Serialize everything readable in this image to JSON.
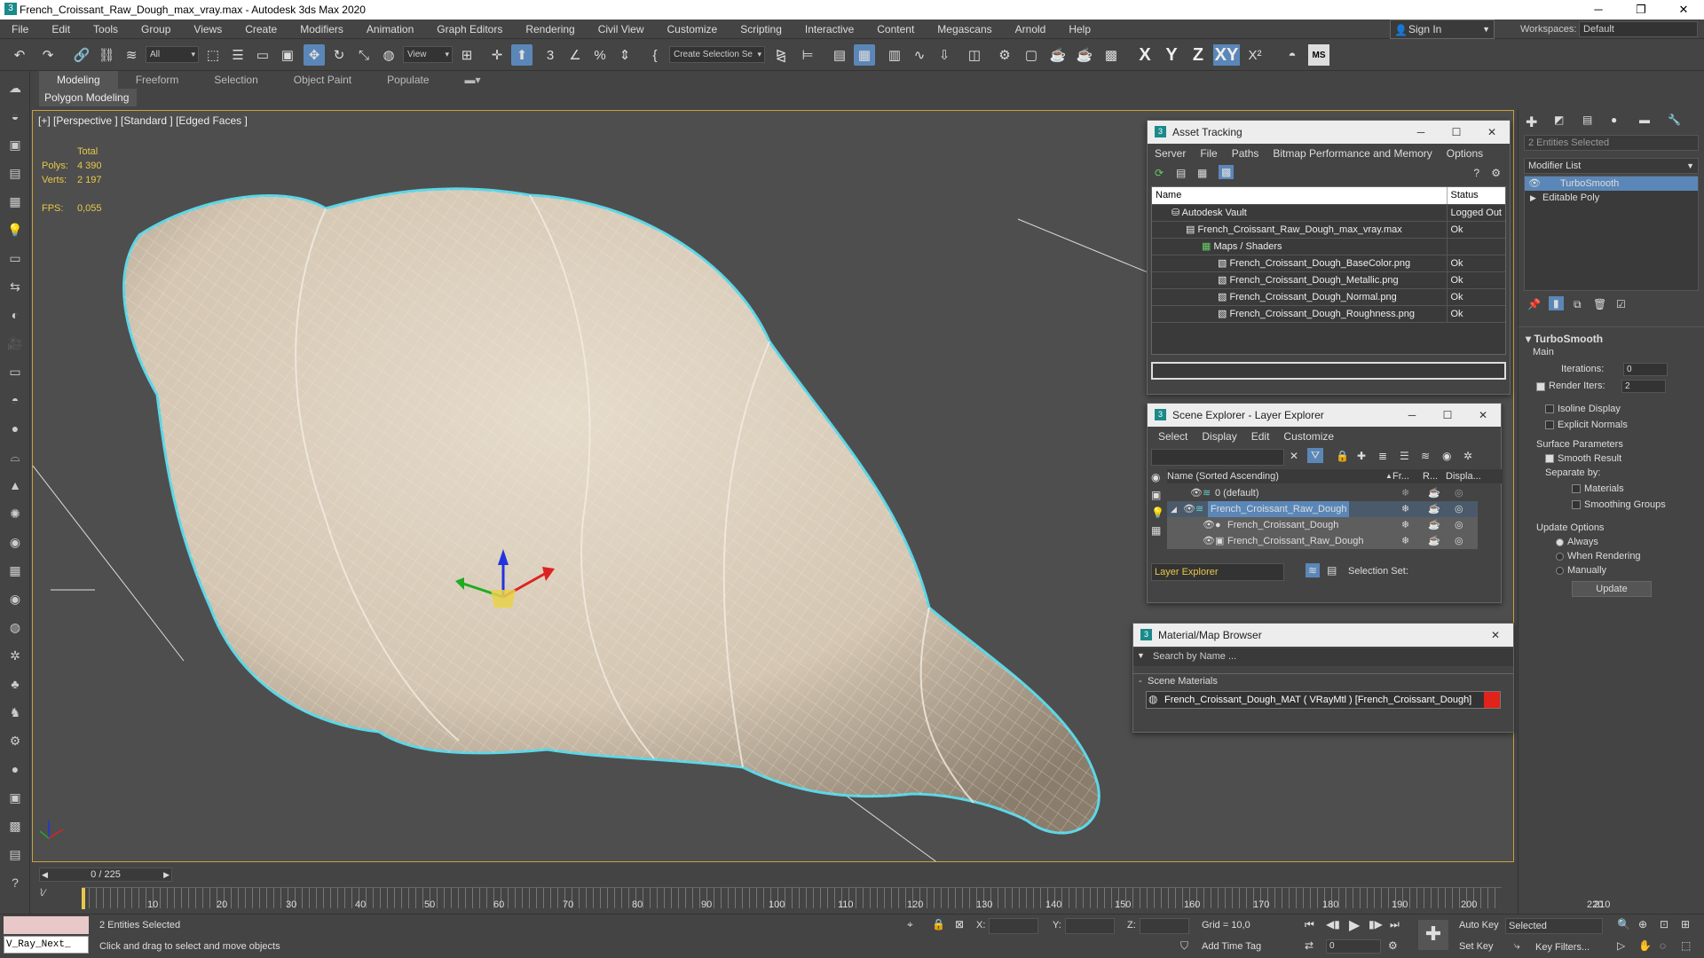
{
  "window": {
    "title": "French_Croissant_Raw_Dough_max_vray.max - Autodesk 3ds Max 2020"
  },
  "menu": [
    "File",
    "Edit",
    "Tools",
    "Group",
    "Views",
    "Create",
    "Modifiers",
    "Animation",
    "Graph Editors",
    "Rendering",
    "Civil View",
    "Customize",
    "Scripting",
    "Interactive",
    "Content",
    "Megascans",
    "Arnold",
    "Help"
  ],
  "signin": "Sign In",
  "workspaces": {
    "label": "Workspaces:",
    "value": "Default"
  },
  "toolbar": {
    "filter": "All",
    "refcoord": "View",
    "selset": "Create Selection Se",
    "axes": [
      "X",
      "Y",
      "Z",
      "XY"
    ]
  },
  "ribbon": {
    "tabs": [
      "Modeling",
      "Freeform",
      "Selection",
      "Object Paint",
      "Populate"
    ],
    "sub": "Polygon Modeling"
  },
  "viewport": {
    "label": "[+] [Perspective ] [Standard ] [Edged Faces ]",
    "stats": {
      "total": "Total",
      "polys_label": "Polys:",
      "polys": "4 390",
      "verts_label": "Verts:",
      "verts": "2 197",
      "fps_label": "FPS:",
      "fps": "0,055"
    }
  },
  "asset_tracking": {
    "title": "Asset Tracking",
    "menu": [
      "Server",
      "File",
      "Paths",
      "Bitmap Performance and Memory",
      "Options"
    ],
    "columns": [
      "Name",
      "Status"
    ],
    "rows": [
      {
        "name": "Autodesk Vault",
        "status": "Logged Out",
        "indent": 1
      },
      {
        "name": "French_Croissant_Raw_Dough_max_vray.max",
        "status": "Ok",
        "indent": 2
      },
      {
        "name": "Maps / Shaders",
        "status": "",
        "indent": 3
      },
      {
        "name": "French_Croissant_Dough_BaseColor.png",
        "status": "Ok",
        "indent": 4
      },
      {
        "name": "French_Croissant_Dough_Metallic.png",
        "status": "Ok",
        "indent": 4
      },
      {
        "name": "French_Croissant_Dough_Normal.png",
        "status": "Ok",
        "indent": 4
      },
      {
        "name": "French_Croissant_Dough_Roughness.png",
        "status": "Ok",
        "indent": 4
      }
    ]
  },
  "scene_explorer": {
    "title": "Scene Explorer - Layer Explorer",
    "menu": [
      "Select",
      "Display",
      "Edit",
      "Customize"
    ],
    "columns": [
      "Name (Sorted Ascending)",
      "Fr...",
      "R...",
      "Displa..."
    ],
    "rows": [
      {
        "name": "0 (default)",
        "indent": 0
      },
      {
        "name": "French_Croissant_Raw_Dough",
        "indent": 0
      },
      {
        "name": "French_Croissant_Dough",
        "indent": 1
      },
      {
        "name": "French_Croissant_Raw_Dough",
        "indent": 1
      }
    ],
    "footer_layer": "Layer Explorer",
    "footer_selset": "Selection Set:"
  },
  "material_browser": {
    "title": "Material/Map Browser",
    "search": "Search by Name ...",
    "section": "Scene Materials",
    "item": "French_Croissant_Dough_MAT ( VRayMtl ) [French_Croissant_Dough]"
  },
  "command_panel": {
    "selected": "2 Entities Selected",
    "modifier_list": "Modifier List",
    "stack": [
      "TurboSmooth",
      "Editable Poly"
    ],
    "rollout": "TurboSmooth",
    "main": "Main",
    "iterations_label": "Iterations:",
    "iterations": "0",
    "render_iters_label": "Render Iters:",
    "render_iters": "2",
    "isoline": "Isoline Display",
    "explicit": "Explicit Normals",
    "surface": "Surface Parameters",
    "smooth": "Smooth Result",
    "separate": "Separate by:",
    "materials": "Materials",
    "smoothing": "Smoothing Groups",
    "update_opts": "Update Options",
    "always": "Always",
    "when_rendering": "When Rendering",
    "manually": "Manually",
    "update": "Update"
  },
  "timeline": {
    "frame": "0 / 225",
    "ticks": [
      "10",
      "20",
      "30",
      "40",
      "50",
      "60",
      "70",
      "80",
      "90",
      "100",
      "110",
      "120",
      "130",
      "140",
      "150",
      "160",
      "170",
      "180",
      "190",
      "200",
      "210",
      "220"
    ]
  },
  "status": {
    "script": "V_Ray_Next_",
    "selected": "2 Entities Selected",
    "prompt": "Click and drag to select and move objects",
    "x": "X:",
    "y": "Y:",
    "z": "Z:",
    "grid": "Grid = 10,0",
    "add_time_tag": "Add Time Tag",
    "auto_key": "Auto Key",
    "set_key": "Set Key",
    "selected_dd": "Selected",
    "key_filters": "Key Filters...",
    "frame": "0"
  },
  "colors": {
    "accent": "#5b87b8",
    "selection_outline": "#5cd6e6",
    "dough": "#d8cbb8",
    "material_red": "#e0231b"
  }
}
